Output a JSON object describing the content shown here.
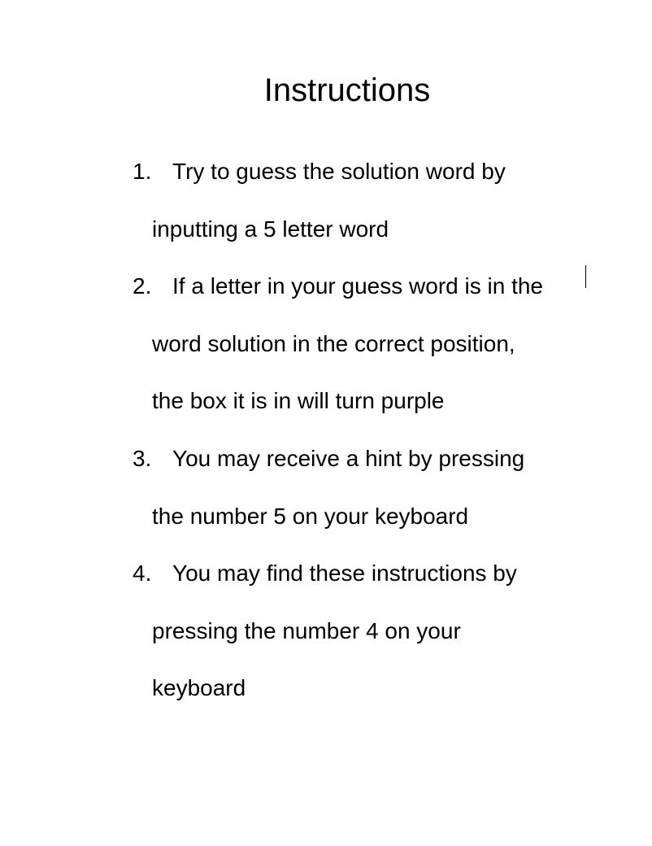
{
  "document": {
    "title": "Instructions",
    "items": [
      {
        "number": "1.",
        "lines": [
          "Try to guess the solution word by",
          "inputting a 5 letter word"
        ]
      },
      {
        "number": "2.",
        "lines": [
          "If a letter in your guess word is in the",
          "word solution in the correct position,",
          "the box it is in will turn purple"
        ]
      },
      {
        "number": "3.",
        "lines": [
          "You may receive a hint by pressing",
          "the number 5 on your keyboard"
        ]
      },
      {
        "number": "4.",
        "lines": [
          "You may find these instructions by",
          "pressing the number 4 on your",
          "keyboard"
        ]
      }
    ]
  }
}
